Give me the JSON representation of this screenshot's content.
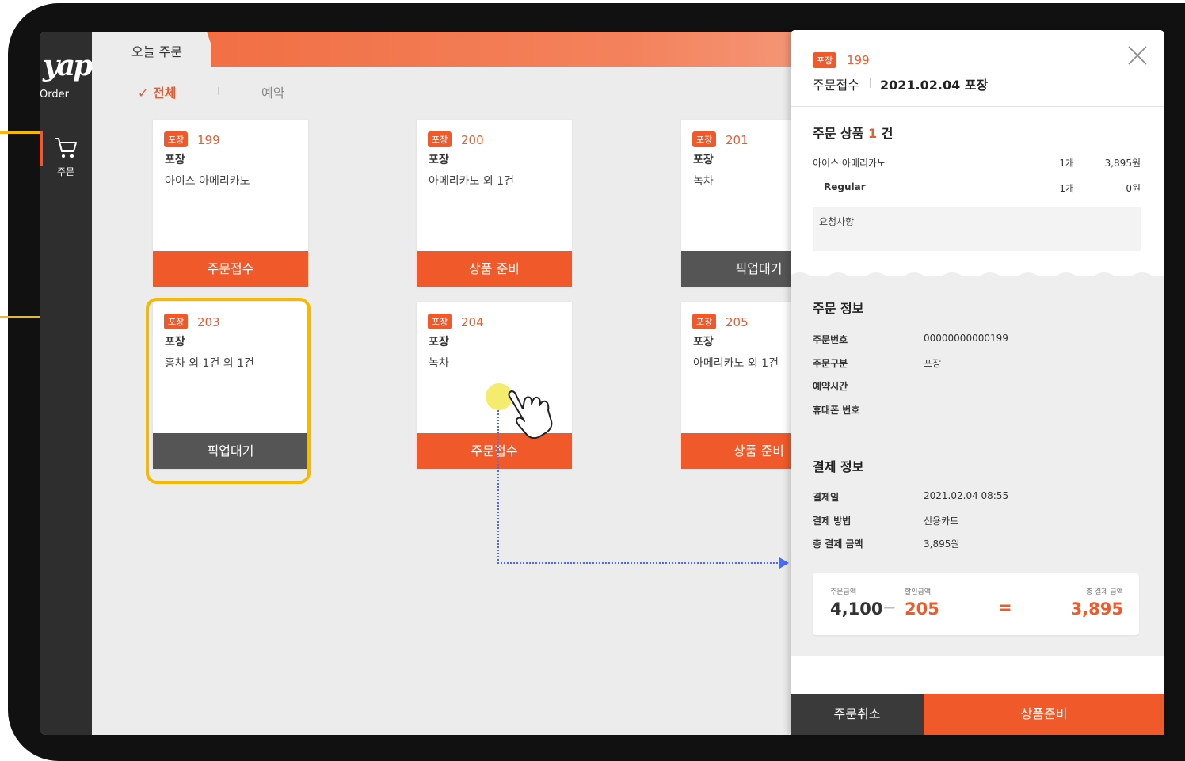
{
  "sidebar": {
    "logo_text": "yap",
    "logo_sub": "Order",
    "nav_order_label": "주문"
  },
  "header": {
    "tab_title": "오늘 주문",
    "filter_all": "✓ 전체",
    "filter_reserve": "예약"
  },
  "orders": [
    {
      "tag": "포장",
      "number": "199",
      "type": "포장",
      "item": "아이스 아메리카노",
      "button": "주문접수"
    },
    {
      "tag": "포장",
      "number": "200",
      "type": "포장",
      "item": "아메리카노 외 1건",
      "button": "상품 준비"
    },
    {
      "tag": "포장",
      "number": "201",
      "type": "포장",
      "item": "녹차",
      "button": "픽업대기"
    },
    {
      "tag": "포장",
      "number": "203",
      "type": "포장",
      "item": "홍차 외 1건 외 1건",
      "button": "픽업대기"
    },
    {
      "tag": "포장",
      "number": "204",
      "type": "포장",
      "item": "녹차",
      "button": "주문접수"
    },
    {
      "tag": "포장",
      "number": "205",
      "type": "포장",
      "item": "아메리카노 외 1건",
      "button": "상품 준비"
    }
  ],
  "detail": {
    "tag": "포장",
    "number": "199",
    "status": "주문접수",
    "date_type": "2021.02.04 포장",
    "products_title": "주문 상품",
    "products_count": "1",
    "products_unit": "건",
    "products": [
      {
        "name": "아이스 아메리카노",
        "qty": "1개",
        "price": "3,895원"
      },
      {
        "name": "Regular",
        "qty": "1개",
        "price": "0원"
      }
    ],
    "request_label": "요청사항",
    "order_info_title": "주문 정보",
    "order_info": [
      {
        "key": "주문번호",
        "value": "00000000000199"
      },
      {
        "key": "주문구분",
        "value": "포장"
      },
      {
        "key": "예약시간",
        "value": ""
      },
      {
        "key": "휴대폰 번호",
        "value": ""
      }
    ],
    "payment_title": "결제 정보",
    "payment_info": [
      {
        "key": "결제일",
        "value": "2021.02.04 08:55"
      },
      {
        "key": "결제 방법",
        "value": "신용카드"
      },
      {
        "key": "총 결제 금액",
        "value": "3,895원"
      }
    ],
    "summary": {
      "order_amount_label": "주문금액",
      "order_amount": "4,100",
      "minus": "−",
      "discount_label": "할인금액",
      "discount": "205",
      "equals": "=",
      "total_label": "총 결제 금액",
      "total": "3,895"
    },
    "cancel_button": "주문취소",
    "prepare_button": "상품준비"
  },
  "colors": {
    "accent": "#f05a2b",
    "highlight": "#f7b800",
    "pointer": "#4a6cf0"
  }
}
